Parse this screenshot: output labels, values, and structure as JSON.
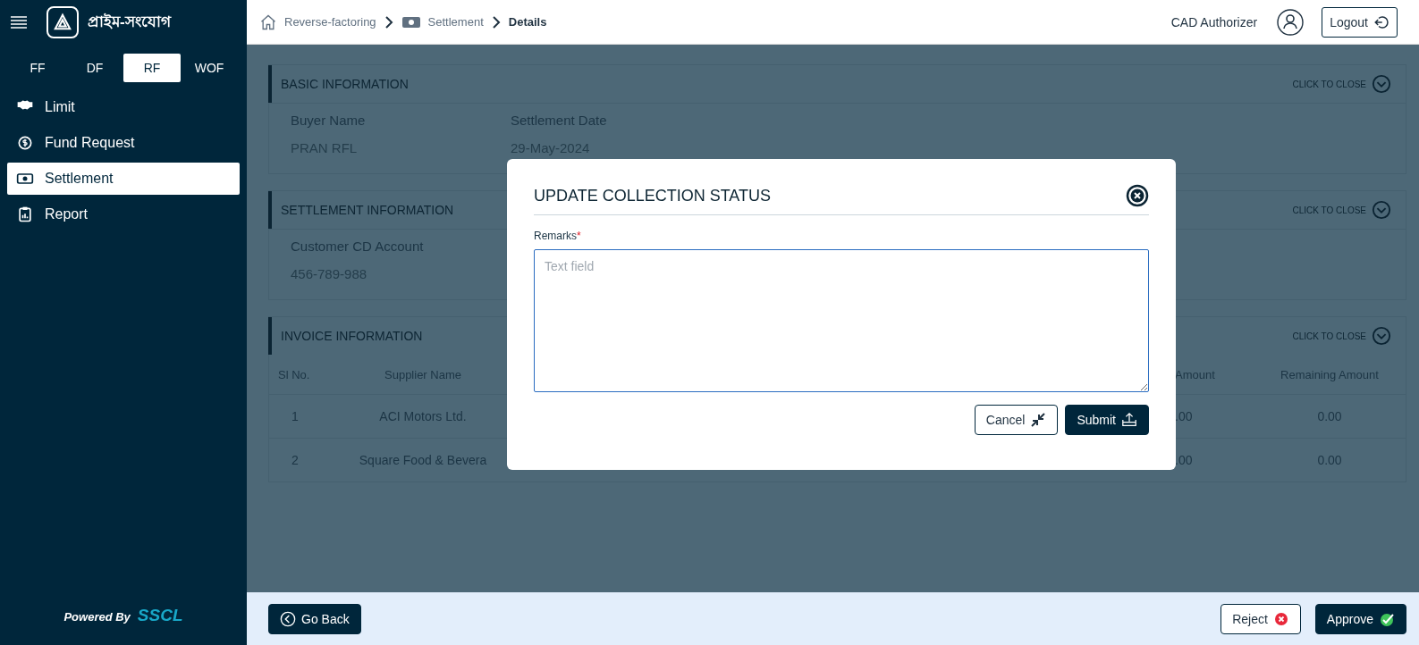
{
  "sidebar": {
    "brand": "প্রাইম-সংযোগ",
    "product_tabs": [
      {
        "label": "FF",
        "selected": false
      },
      {
        "label": "DF",
        "selected": false
      },
      {
        "label": "RF",
        "selected": true
      },
      {
        "label": "WOF",
        "selected": false
      }
    ],
    "menu": [
      {
        "label": "Limit",
        "selected": false
      },
      {
        "label": "Fund Request",
        "selected": false
      },
      {
        "label": "Settlement",
        "selected": true
      },
      {
        "label": "Report",
        "selected": false
      }
    ],
    "powered_by": "Powered By",
    "vendor": "SSCL"
  },
  "header": {
    "breadcrumbs": [
      "Reverse-factoring",
      "Settlement",
      "Details"
    ],
    "user": "CAD Authorizer",
    "logout": "Logout"
  },
  "sections": [
    {
      "title": "BASIC INFORMATION",
      "toggle": "CLICK TO CLOSE",
      "fields": [
        {
          "label": "Buyer Name",
          "value": "PRAN RFL"
        },
        {
          "label": "Settlement Date",
          "value": "29-May-2024"
        }
      ]
    },
    {
      "title": "SETTLEMENT INFORMATION",
      "toggle": "CLICK TO CLOSE",
      "fields": [
        {
          "label": "Customer CD Account",
          "value": "456-789-988"
        }
      ]
    }
  ],
  "invoice": {
    "title": "INVOICE INFORMATION",
    "toggle": "CLICK TO CLOSE",
    "columns": [
      "Sl No.",
      "Supplier Name",
      "Amount",
      "Remaining Amount"
    ],
    "rows": [
      [
        "1",
        "ACI Motors Ltd.",
        ".00",
        "0.00"
      ],
      [
        "2",
        "Square Food & Bevera",
        ".00",
        "0.00"
      ]
    ]
  },
  "modal": {
    "title": "UPDATE COLLECTION STATUS",
    "field_label": "Remarks",
    "required_mark": "*",
    "placeholder": "Text field",
    "cancel": "Cancel",
    "submit": "Submit"
  },
  "footer": {
    "back": "Go Back",
    "reject": "Reject",
    "approve": "Approve"
  }
}
